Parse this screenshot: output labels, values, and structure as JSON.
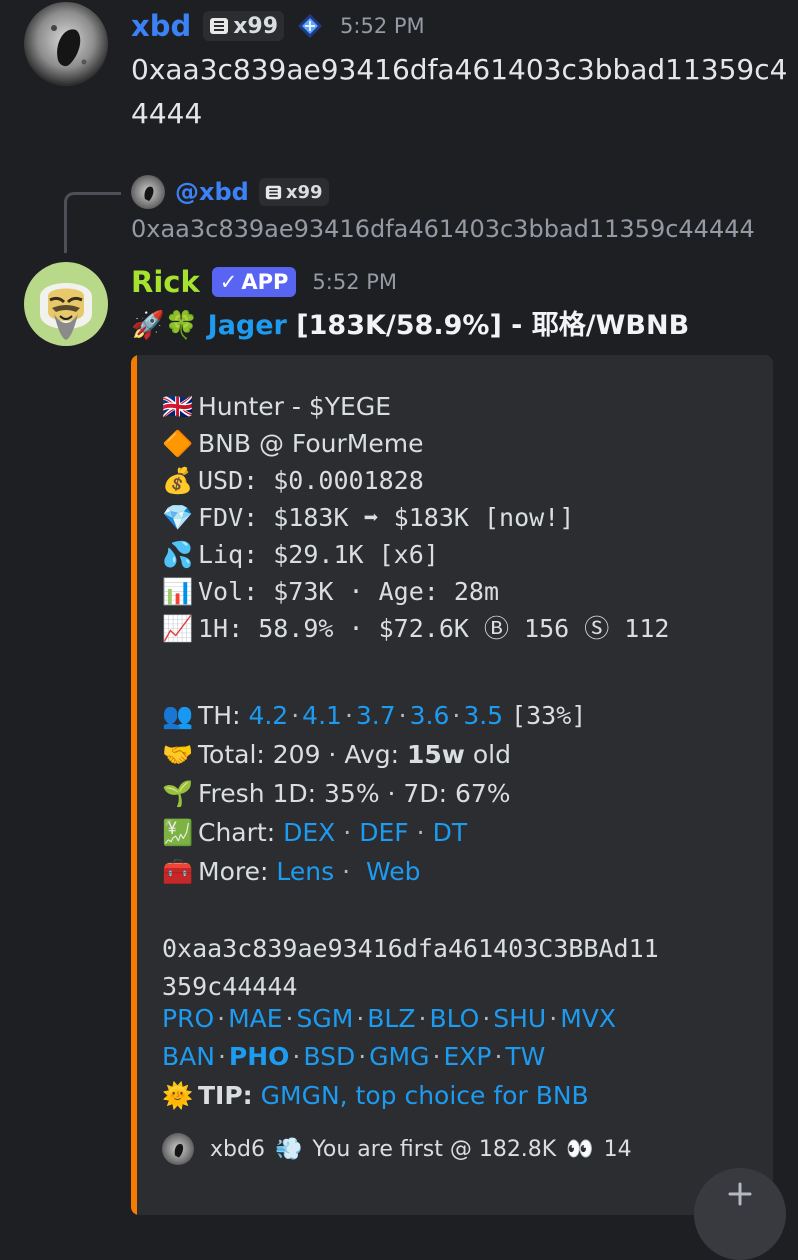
{
  "msg1": {
    "author": "xbd",
    "badge_count": "x99",
    "time": "5:52 PM",
    "line1": "0xaa3c839ae93416dfa461403c3bbad11359c4",
    "line2": "4444"
  },
  "reply": {
    "mention": "@xbd",
    "badge_count": "x99",
    "text": "0xaa3c839ae93416dfa461403c3bbad11359c44444"
  },
  "msg2": {
    "author": "Rick",
    "app_badge": "APP",
    "time": "5:52 PM",
    "title_emojis": "🚀🍀",
    "title_link": "Jager",
    "title_rest": " [183K/58.9%] - 耶格/WBNB"
  },
  "embed": {
    "accent": "#f57c00",
    "rows": {
      "name": {
        "icon": "🇬🇧",
        "text": "Hunter - $YEGE"
      },
      "chain": {
        "icon": "🔶",
        "text": "BNB @ FourMeme"
      },
      "usd": {
        "icon": "💰",
        "text": "USD: $0.0001828"
      },
      "fdv": {
        "icon": "💎",
        "text": "FDV: $183K ➡ $183K [now!]"
      },
      "liq": {
        "icon": "💦",
        "text": "Liq: $29.1K [x6]"
      },
      "vol": {
        "icon": "📊",
        "text": "Vol: $73K · Age: 28m"
      },
      "h1": {
        "icon": "📈",
        "text": "1H: 58.9% · $72.6K Ⓑ 156 Ⓢ 112"
      }
    },
    "th": {
      "icon": "👥",
      "label": "TH:",
      "values": [
        "4.2",
        "4.1",
        "3.7",
        "3.6",
        "3.5"
      ],
      "suffix": "[33%]"
    },
    "total": {
      "icon": "🤝",
      "prefix": "Total: 209 · Avg: ",
      "bold": "15w",
      "suffix": " old"
    },
    "fresh": {
      "icon": "🌱",
      "text": "Fresh 1D: 35% · 7D: 67%"
    },
    "chart": {
      "icon": "💹",
      "label": "Chart:",
      "links": [
        "DEX",
        "DEF",
        "DT"
      ]
    },
    "more": {
      "icon": "🧰",
      "label": "More:",
      "links": [
        "Lens",
        "Web"
      ]
    },
    "address_line1": "0xaa3c839ae93416dfa461403C3BBAd11",
    "address_line2": "359c44444",
    "links_row1": [
      "PRO",
      "MAE",
      "SGM",
      "BLZ",
      "BLO",
      "SHU",
      "MVX"
    ],
    "links_row2": [
      "BAN",
      "PHO",
      "BSD",
      "GMG",
      "EXP",
      "TW"
    ],
    "tip": {
      "icon": "🌞",
      "label": "TIP:",
      "text": "GMGN, top choice for BNB"
    },
    "footer": {
      "user": "xbd6",
      "icon": "💨",
      "text": "You are first @ 182.8K",
      "eyes": "👀",
      "count": "14"
    }
  },
  "fab": {
    "icon": "plus-icon"
  }
}
